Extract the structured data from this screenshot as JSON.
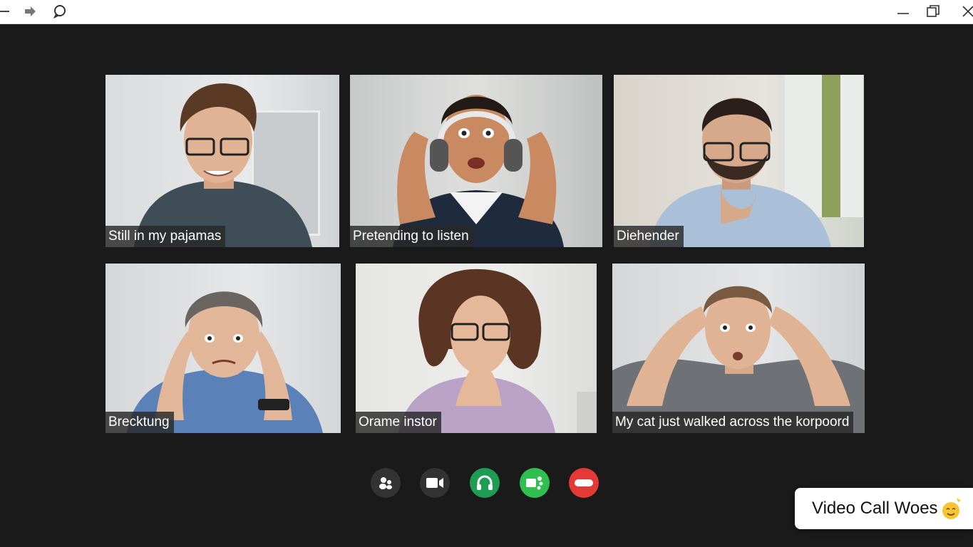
{
  "window": {
    "back_icon": "back-arrow-icon",
    "forward_icon": "forward-arrow-icon",
    "chat_icon": "chat-bubble-icon",
    "minimize_icon": "minimize-icon",
    "restore_icon": "restore-icon",
    "close_icon": "close-icon"
  },
  "participants": [
    {
      "caption": "Still in my pajamas"
    },
    {
      "caption": "Pretending to listen"
    },
    {
      "caption": "Diehender"
    },
    {
      "caption": "Brecktung"
    },
    {
      "caption": "Orame instor"
    },
    {
      "caption": "My cat just walked across the korpoord"
    }
  ],
  "controls": [
    {
      "icon": "participants-icon",
      "color": "#333333"
    },
    {
      "icon": "video-camera-icon",
      "color": "#333333"
    },
    {
      "icon": "headset-icon",
      "color": "#1f9d55"
    },
    {
      "icon": "share-screen-icon",
      "color": "#2fbf50"
    },
    {
      "icon": "end-call-icon",
      "color": "#e53935"
    }
  ],
  "notification": {
    "text": "Video Call Woes",
    "emoji_icon": "smiling-emoji-icon"
  }
}
